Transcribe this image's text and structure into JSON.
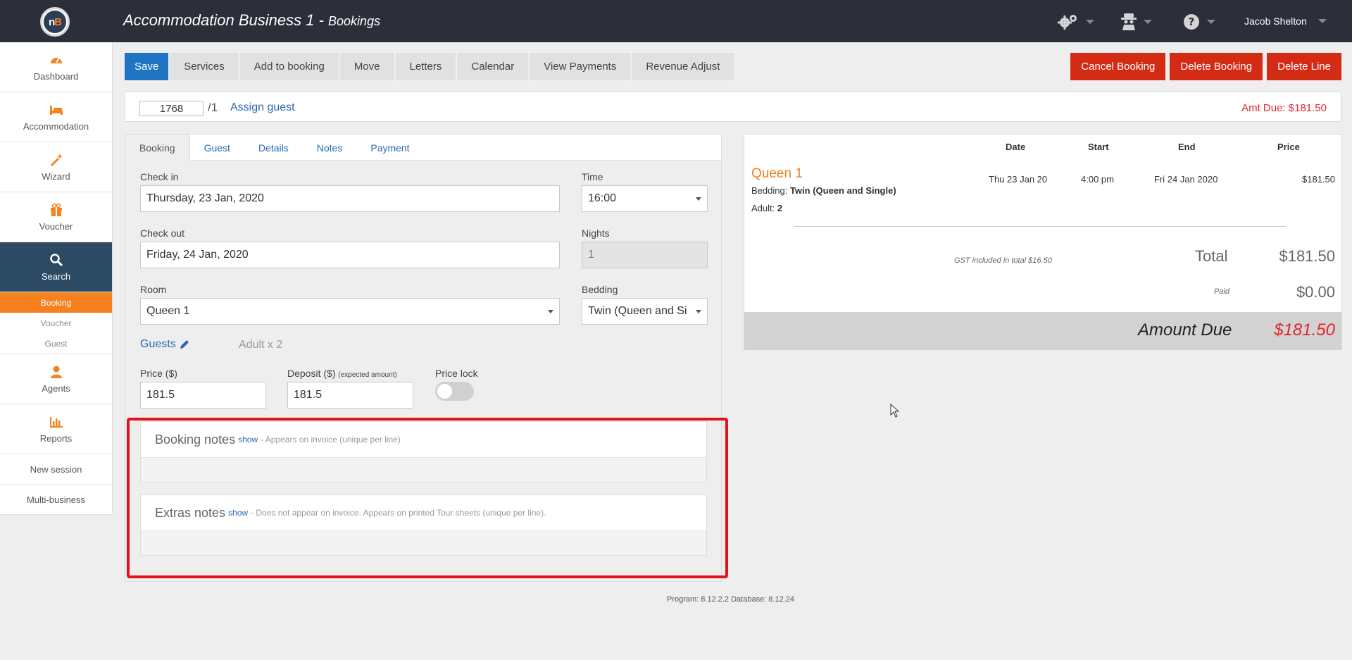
{
  "header": {
    "logo_text_n": "n",
    "logo_text_b": "B",
    "business": "Accommodation Business 1 -",
    "section": "Bookings",
    "user": "Jacob Shelton"
  },
  "sidebar": {
    "dashboard": "Dashboard",
    "accommodation": "Accommodation",
    "wizard": "Wizard",
    "voucher": "Voucher",
    "search": "Search",
    "sub": [
      "Booking",
      "Voucher",
      "Guest"
    ],
    "agents": "Agents",
    "reports": "Reports",
    "new_session": "New session",
    "multi_business": "Multi-business"
  },
  "toolbar": {
    "save": "Save",
    "services": "Services",
    "add_to_booking": "Add to booking",
    "move": "Move",
    "letters": "Letters",
    "calendar": "Calendar",
    "view_payments": "View Payments",
    "revenue_adjust": "Revenue Adjust",
    "cancel_booking": "Cancel Booking",
    "delete_booking": "Delete Booking",
    "delete_line": "Delete Line"
  },
  "refbar": {
    "booking_number": "1768",
    "line_suffix": "/1",
    "assign_guest": "Assign guest",
    "amt_due": "Amt Due: $181.50"
  },
  "tabs": [
    "Booking",
    "Guest",
    "Details",
    "Notes",
    "Payment"
  ],
  "form": {
    "checkin_label": "Check in",
    "checkin_value": "Thursday, 23 Jan, 2020",
    "time_label": "Time",
    "time_value": "16:00",
    "checkout_label": "Check out",
    "checkout_value": "Friday, 24 Jan, 2020",
    "nights_label": "Nights",
    "nights_value": "1",
    "room_label": "Room",
    "room_value": "Queen 1",
    "bedding_label": "Bedding",
    "bedding_value": "Twin (Queen and Si",
    "guests_label": "Guests",
    "adult_count": "Adult x 2",
    "price_label": "Price ($)",
    "price_value": "181.5",
    "deposit_label": "Deposit ($)",
    "deposit_note": "(expected amount)",
    "deposit_value": "181.5",
    "price_lock_label": "Price lock"
  },
  "notes": {
    "booking_title": "Booking notes",
    "booking_show": "show",
    "booking_desc": "- Appears on invoice (unique per line)",
    "extras_title": "Extras notes",
    "extras_show": "show",
    "extras_desc": "- Does not appear on invoice. Appears on printed Tour sheets (unique per line)."
  },
  "summary": {
    "columns": [
      "Date",
      "Start",
      "End",
      "Price"
    ],
    "room": "Queen 1",
    "bedding_prefix": "Bedding:",
    "bedding": "Twin (Queen and Single)",
    "adult_prefix": "Adult:",
    "adult": "2",
    "date": "Thu 23 Jan 20",
    "start": "4:00 pm",
    "end": "Fri 24 Jan 2020",
    "price": "$181.50",
    "gst": "GST included in total $16.50",
    "total_label": "Total",
    "total": "$181.50",
    "paid_label": "Paid",
    "paid": "$0.00",
    "amount_due_label": "Amount Due",
    "amount_due": "$181.50"
  },
  "footer": {
    "version": "Program: 8.12.2.2 Database: 8.12.24"
  },
  "colors": {
    "accent_orange": "#f5811f",
    "primary_blue": "#1f74c4",
    "danger_red": "#d42b14",
    "highlight_red": "#e3111b"
  }
}
